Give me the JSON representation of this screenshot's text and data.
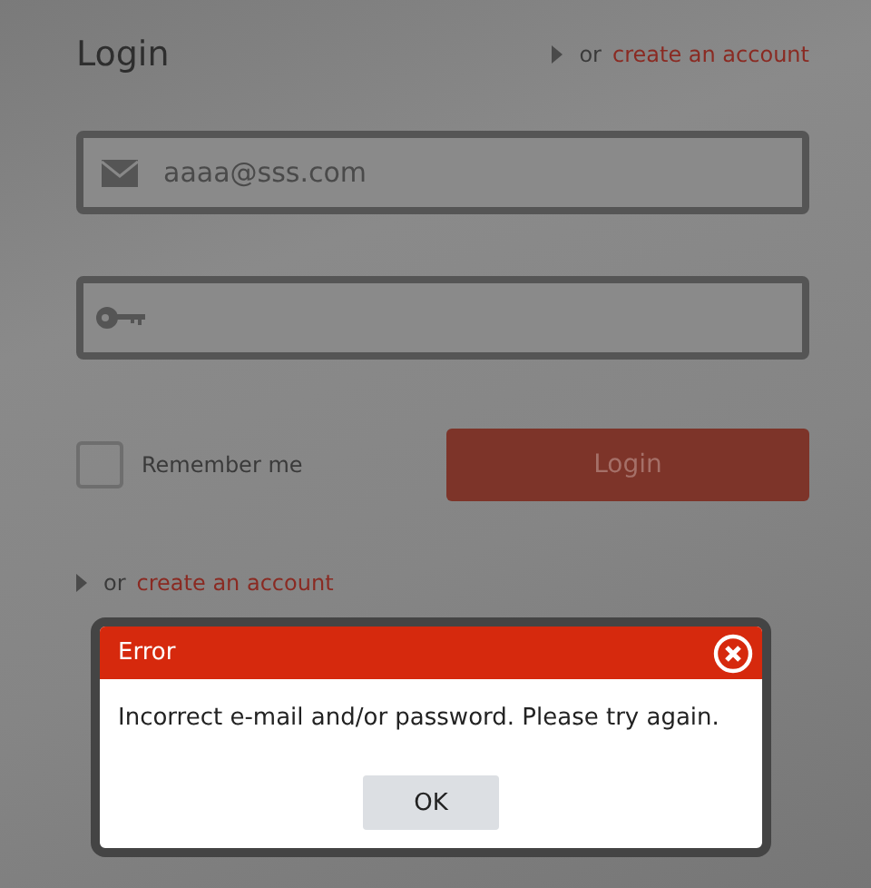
{
  "login": {
    "title": "Login",
    "top_link": {
      "prefix": "or",
      "link": "create an account"
    },
    "email": {
      "value": "aaaa@sss.com"
    },
    "remember": {
      "label": "Remember me",
      "checked": false
    },
    "button": "Login",
    "bottom_link": {
      "prefix": "or",
      "link": "create an account"
    }
  },
  "dialog": {
    "title": "Error",
    "message": "Incorrect e-mail and/or password. Please try again.",
    "button": "OK"
  }
}
